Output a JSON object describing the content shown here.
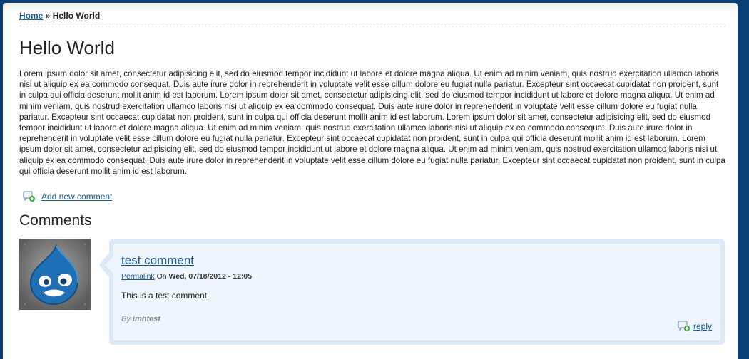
{
  "breadcrumb": {
    "home": "Home",
    "separator": "»",
    "current": "Hello World"
  },
  "page": {
    "title": "Hello World",
    "body": "Lorem ipsum dolor sit amet, consectetur adipisicing elit, sed do eiusmod tempor incididunt ut labore et dolore magna aliqua. Ut enim ad minim veniam, quis nostrud exercitation ullamco laboris nisi ut aliquip ex ea commodo consequat. Duis aute irure dolor in reprehenderit in voluptate velit esse cillum dolore eu fugiat nulla pariatur. Excepteur sint occaecat cupidatat non proident, sunt in culpa qui officia deserunt mollit anim id est laborum. Lorem ipsum dolor sit amet, consectetur adipisicing elit, sed do eiusmod tempor incididunt ut labore et dolore magna aliqua. Ut enim ad minim veniam, quis nostrud exercitation ullamco laboris nisi ut aliquip ex ea commodo consequat. Duis aute irure dolor in reprehenderit in voluptate velit esse cillum dolore eu fugiat nulla pariatur. Excepteur sint occaecat cupidatat non proident, sunt in culpa qui officia deserunt mollit anim id est laborum. Lorem ipsum dolor sit amet, consectetur adipisicing elit, sed do eiusmod tempor incididunt ut labore et dolore magna aliqua. Ut enim ad minim veniam, quis nostrud exercitation ullamco laboris nisi ut aliquip ex ea commodo consequat. Duis aute irure dolor in reprehenderit in voluptate velit esse cillum dolore eu fugiat nulla pariatur. Excepteur sint occaecat cupidatat non proident, sunt in culpa qui officia deserunt mollit anim id est laborum. Lorem ipsum dolor sit amet, consectetur adipisicing elit, sed do eiusmod tempor incididunt ut labore et dolore magna aliqua. Ut enim ad minim veniam, quis nostrud exercitation ullamco laboris nisi ut aliquip ex ea commodo consequat. Duis aute irure dolor in reprehenderit in voluptate velit esse cillum dolore eu fugiat nulla pariatur. Excepteur sint occaecat cupidatat non proident, sunt in culpa qui officia deserunt mollit anim id est laborum."
  },
  "add_comment": {
    "label": "Add new comment",
    "icon": "comment-add-icon"
  },
  "comments": {
    "heading": "Comments",
    "items": [
      {
        "title": "test comment",
        "permalink": "Permalink",
        "on_label": "On",
        "date": "Wed, 07/18/2012 - 12:05",
        "body": "This is a test comment",
        "by_label": "By",
        "author": "imhtest",
        "reply_label": "reply",
        "avatar_icon": "drupal-drop-icon"
      }
    ]
  },
  "colors": {
    "frame": "#0b3f78",
    "link": "#1a5a96",
    "bubble": "#dbe9f8",
    "bubble_inner": "#eef5fd"
  }
}
